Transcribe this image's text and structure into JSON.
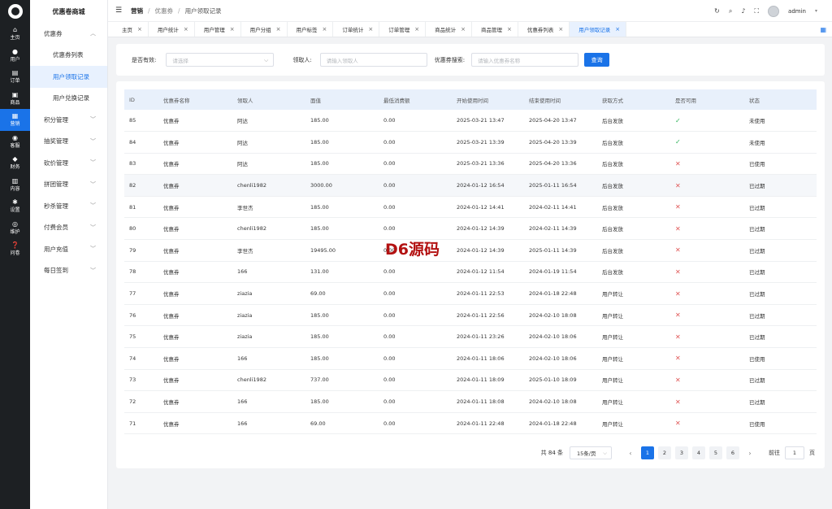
{
  "rail": {
    "items": [
      {
        "label": "主页",
        "icon": "⌂",
        "icon_name": "home-icon"
      },
      {
        "label": "用户",
        "icon": "●",
        "icon_name": "user-icon"
      },
      {
        "label": "订单",
        "icon": "▤",
        "icon_name": "order-icon"
      },
      {
        "label": "商品",
        "icon": "▣",
        "icon_name": "goods-icon"
      },
      {
        "label": "营销",
        "icon": "▦",
        "icon_name": "marketing-icon"
      },
      {
        "label": "客服",
        "icon": "◉",
        "icon_name": "service-icon"
      },
      {
        "label": "财务",
        "icon": "◆",
        "icon_name": "finance-icon"
      },
      {
        "label": "内容",
        "icon": "▥",
        "icon_name": "content-icon"
      },
      {
        "label": "设置",
        "icon": "✱",
        "icon_name": "settings-icon"
      },
      {
        "label": "维护",
        "icon": "◎",
        "icon_name": "maintain-icon"
      },
      {
        "label": "问卷",
        "icon": "❓",
        "icon_name": "survey-icon"
      }
    ]
  },
  "submenu": {
    "brand": "优惠卷商城",
    "group_coupon": "优惠券",
    "item_coupon_list": "优惠券列表",
    "item_user_claim": "用户领取记录",
    "item_user_redeem": "用户兑换记录",
    "groups": [
      "积分管理",
      "抽奖管理",
      "砍价管理",
      "拼团管理",
      "秒杀管理",
      "付费会员",
      "用户充值",
      "每日签到"
    ]
  },
  "header": {
    "crumb1": "营销",
    "crumb2": "优惠券",
    "crumb3": "用户领取记录",
    "user": "admin"
  },
  "tabs": [
    "主页",
    "用户统计",
    "用户管理",
    "用户分组",
    "用户标签",
    "订单统计",
    "订单管理",
    "商品统计",
    "商品管理",
    "优惠券列表",
    "用户领取记录"
  ],
  "filter": {
    "valid_label": "是否有效:",
    "valid_placeholder": "请选择",
    "receiver_label": "领取人:",
    "receiver_placeholder": "请输入领取人",
    "search_label": "优惠券搜索:",
    "search_placeholder": "请输入优惠券名称",
    "query_button": "查询"
  },
  "table": {
    "columns": [
      "ID",
      "优惠券名称",
      "领取人",
      "面值",
      "最低消费额",
      "开始使用时间",
      "结束使用时间",
      "获取方式",
      "是否可用",
      "状态"
    ],
    "rows": [
      [
        "85",
        "优惠券",
        "阿达",
        "185.00",
        "0.00",
        "2025-03-21 13:47",
        "2025-04-20 13:47",
        "后台发放",
        "yes",
        "未使用"
      ],
      [
        "84",
        "优惠券",
        "阿达",
        "185.00",
        "0.00",
        "2025-03-21 13:39",
        "2025-04-20 13:39",
        "后台发放",
        "yes",
        "未使用"
      ],
      [
        "83",
        "优惠券",
        "阿达",
        "185.00",
        "0.00",
        "2025-03-21 13:36",
        "2025-04-20 13:36",
        "后台发放",
        "no",
        "已使用"
      ],
      [
        "82",
        "优惠券",
        "chenli1982",
        "3000.00",
        "0.00",
        "2024-01-12 16:54",
        "2025-01-11 16:54",
        "后台发放",
        "no",
        "已过期"
      ],
      [
        "81",
        "优惠券",
        "李世杰",
        "185.00",
        "0.00",
        "2024-01-12 14:41",
        "2024-02-11 14:41",
        "后台发放",
        "no",
        "已过期"
      ],
      [
        "80",
        "优惠券",
        "chenli1982",
        "185.00",
        "0.00",
        "2024-01-12 14:39",
        "2024-02-11 14:39",
        "后台发放",
        "no",
        "已过期"
      ],
      [
        "79",
        "优惠券",
        "李世杰",
        "19495.00",
        "0.00",
        "2024-01-12 14:39",
        "2025-01-11 14:39",
        "后台发放",
        "no",
        "已过期"
      ],
      [
        "78",
        "优惠券",
        "166",
        "131.00",
        "0.00",
        "2024-01-12 11:54",
        "2024-01-19 11:54",
        "后台发放",
        "no",
        "已过期"
      ],
      [
        "77",
        "优惠券",
        "ziazia",
        "69.00",
        "0.00",
        "2024-01-11 22:53",
        "2024-01-18 22:48",
        "用户转让",
        "no",
        "已过期"
      ],
      [
        "76",
        "优惠券",
        "ziazia",
        "185.00",
        "0.00",
        "2024-01-11 22:56",
        "2024-02-10 18:08",
        "用户转让",
        "no",
        "已过期"
      ],
      [
        "75",
        "优惠券",
        "ziazia",
        "185.00",
        "0.00",
        "2024-01-11 23:26",
        "2024-02-10 18:06",
        "用户转让",
        "no",
        "已过期"
      ],
      [
        "74",
        "优惠券",
        "166",
        "185.00",
        "0.00",
        "2024-01-11 18:06",
        "2024-02-10 18:06",
        "用户转让",
        "no",
        "已使用"
      ],
      [
        "73",
        "优惠券",
        "chenli1982",
        "737.00",
        "0.00",
        "2024-01-11 18:09",
        "2025-01-10 18:09",
        "用户转让",
        "no",
        "已过期"
      ],
      [
        "72",
        "优惠券",
        "166",
        "185.00",
        "0.00",
        "2024-01-11 18:08",
        "2024-02-10 18:08",
        "用户转让",
        "no",
        "已过期"
      ],
      [
        "71",
        "优惠券",
        "166",
        "69.00",
        "0.00",
        "2024-01-11 22:48",
        "2024-01-18 22:48",
        "用户转让",
        "no",
        "已使用"
      ]
    ]
  },
  "pager": {
    "total": "共 84 条",
    "page_size": "15条/页",
    "pages": [
      "1",
      "2",
      "3",
      "4",
      "5",
      "6"
    ],
    "goto_label": "前往",
    "goto_value": "1",
    "page_unit": "页"
  },
  "watermark": "D6源码",
  "colors": {
    "accent": "#1a73e8",
    "rail_bg": "#1d2023",
    "ok": "#2fb35a",
    "no": "#e05656"
  }
}
